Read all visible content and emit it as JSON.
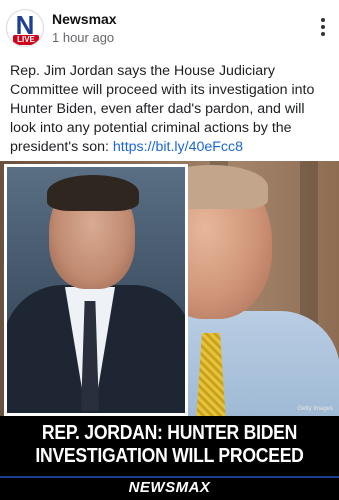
{
  "post": {
    "page_name": "Newsmax",
    "time": "1 hour ago",
    "avatar": {
      "letter": "N",
      "badge": "LIVE"
    },
    "caption_text": "Rep. Jim Jordan says the House Judiciary Committee will proceed with its investigation into Hunter Biden, even after dad's pardon, and will look into any potential criminal actions by the president's son: ",
    "caption_link": "https://bit.ly/40eFcc8"
  },
  "image": {
    "credit": "Getty Images",
    "headline_line1": "REP. JORDAN: HUNTER BIDEN",
    "headline_line2": "INVESTIGATION WILL PROCEED",
    "brand": "NEWSMAX"
  },
  "colors": {
    "link": "#1a66d6",
    "live_badge": "#d0021b",
    "brand_blue": "#1c3f94"
  },
  "icons": {
    "more": "vertical-ellipsis-icon"
  }
}
